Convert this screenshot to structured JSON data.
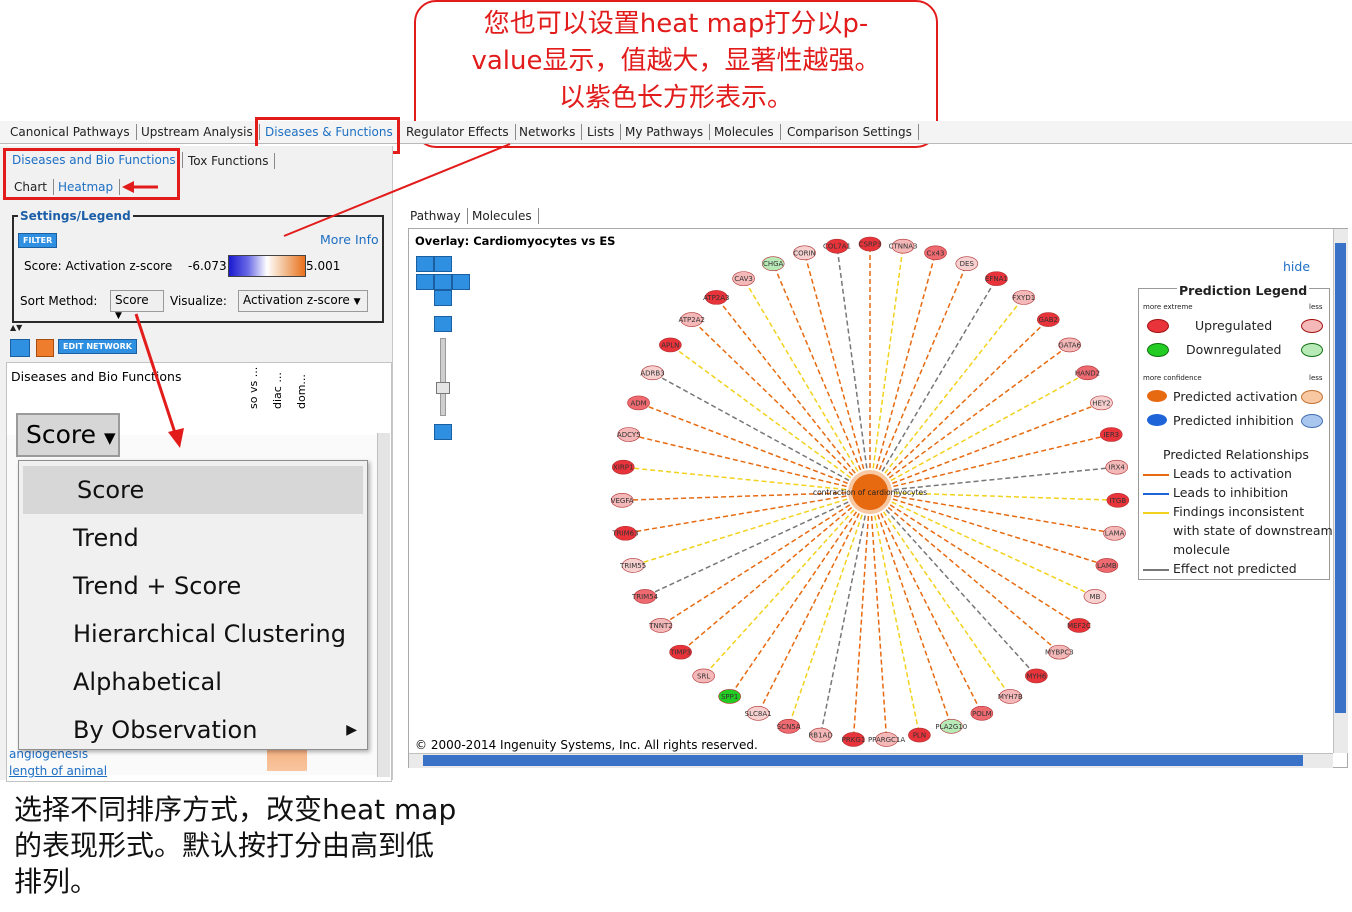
{
  "callout_top": {
    "line1": "您也可以设置heat map打分以p-",
    "line2": "value显示，值越大，显著性越强。",
    "line3": "以紫色长方形表示。"
  },
  "caption_bottom": {
    "line1": "选择不同排序方式，改变heat map",
    "line2": "的表现形式。默认按打分由高到低",
    "line3": "排列。"
  },
  "main_tabs": [
    "Canonical Pathways",
    "Upstream Analysis",
    "Diseases & Functions",
    "Regulator Effects",
    "Networks",
    "Lists",
    "My Pathways",
    "Molecules",
    "Comparison Settings"
  ],
  "sub_tabs": [
    "Diseases and Bio Functions",
    "Tox Functions"
  ],
  "view_tabs": [
    "Chart",
    "Heatmap"
  ],
  "settings": {
    "title": "Settings/Legend",
    "filter_label": "FILTER",
    "more_info": "More Info",
    "score_label": "Score: Activation z-score",
    "score_min": "-6.073",
    "score_max": "5.001",
    "sort_label": "Sort Method:",
    "sort_value": "Score",
    "visualize_label": "Visualize:",
    "visualize_value": "Activation z-score"
  },
  "toolbar": {
    "edit_network": "EDIT NETWORK"
  },
  "heatmap_panel": {
    "header": "Diseases and Bio Functions",
    "columns": [
      "so vs ...",
      "diac ...",
      "dom..."
    ],
    "sort_button": "Score",
    "rows_visible": [
      "angiogenesis",
      "length of animal"
    ]
  },
  "sort_menu": [
    "Score",
    "Trend",
    "Trend + Score",
    "Hierarchical Clustering",
    "Alphabetical",
    "By Observation"
  ],
  "right_tabs": [
    "Pathway",
    "Molecules"
  ],
  "overlay": {
    "title": "Overlay: Cardiomyocytes vs ES",
    "hide": "hide",
    "center_label": "contraction of cardiomyocytes",
    "copyright": "© 2000-2014 Ingenuity Systems, Inc. All rights reserved."
  },
  "legend": {
    "title": "Prediction Legend",
    "more_extreme": "more extreme",
    "less": "less",
    "upregulated": "Upregulated",
    "downregulated": "Downregulated",
    "more_confidence": "more confidence",
    "predicted_activation": "Predicted activation",
    "predicted_inhibition": "Predicted inhibition",
    "relationships_title": "Predicted Relationships",
    "leads_activation": "Leads to activation",
    "leads_inhibition": "Leads to inhibition",
    "findings_inconsistent_1": "Findings inconsistent",
    "findings_inconsistent_2": "with state of downstream",
    "findings_inconsistent_3": "molecule",
    "effect_not_predicted": "Effect not predicted"
  },
  "colors": {
    "upregulated": "#e8333a",
    "upregulated_light": "#f5b8b8",
    "downregulated": "#22cc22",
    "downregulated_light": "#b8eab8",
    "activation": "#e86a10",
    "activation_light": "#f7c8a2",
    "inhibition": "#1e64d8",
    "inhibition_light": "#a9c6ef",
    "annotation_red": "#e21b1b"
  },
  "genes": [
    "CSRP3",
    "CTNNA3",
    "Cx43",
    "DES",
    "EFNA1",
    "FXYD1",
    "GAB2",
    "GATA6",
    "HAND2",
    "HEY2",
    "IER3",
    "IRX4",
    "ITGB",
    "LAMA",
    "LAMB",
    "MB",
    "MEF2C",
    "MYBPC3",
    "MYH6",
    "MYH7B",
    "POLM",
    "PLA2G10",
    "PLN",
    "PPARGC1A",
    "PRKG1",
    "RB1AD",
    "SCN5A",
    "SLC8A1",
    "SPP1",
    "SRL",
    "TIMP3",
    "TNNT2",
    "TRIM54",
    "TRIM55",
    "TRIM63",
    "VEGFA",
    "XIRP1",
    "ADCY5",
    "ADM",
    "ADRB3",
    "APLN",
    "ATP2A2",
    "ATP2A3",
    "CAV3",
    "CHGA",
    "CORIN",
    "COL7A1"
  ]
}
